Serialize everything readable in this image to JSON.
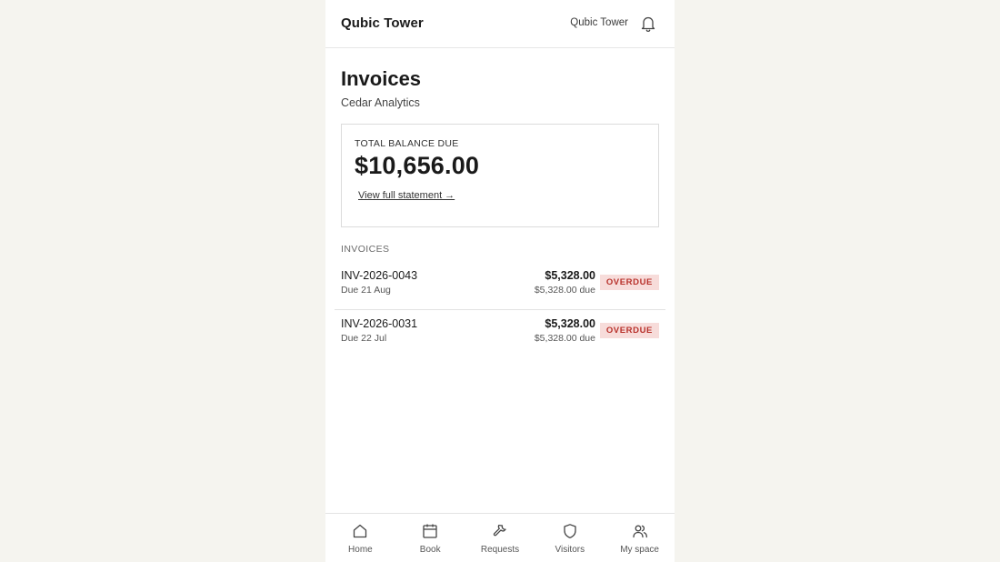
{
  "header": {
    "brand": "Qubic Tower",
    "building": "Qubic Tower",
    "bell_icon": "bell-icon"
  },
  "page": {
    "title": "Invoices",
    "tenant": "Cedar Analytics"
  },
  "balance": {
    "label": "TOTAL BALANCE DUE",
    "amount": "$10,656.00",
    "link": "View full statement →"
  },
  "invoices_section": {
    "label": "INVOICES",
    "items": [
      {
        "number": "INV-2026-0043",
        "due": "Due 21 Aug",
        "amount": "$5,328.00",
        "remaining": "$5,328.00 due",
        "status": "OVERDUE"
      },
      {
        "number": "INV-2026-0031",
        "due": "Due 22 Jul",
        "amount": "$5,328.00",
        "remaining": "$5,328.00 due",
        "status": "OVERDUE"
      }
    ]
  },
  "nav": {
    "items": [
      {
        "label": "Home",
        "icon": "home-icon"
      },
      {
        "label": "Book",
        "icon": "calendar-icon"
      },
      {
        "label": "Requests",
        "icon": "wrench-icon"
      },
      {
        "label": "Visitors",
        "icon": "shield-icon"
      },
      {
        "label": "My space",
        "icon": "people-icon"
      }
    ]
  },
  "colors": {
    "background": "#f5f4ef",
    "overdue_badge_bg": "#f7dcda",
    "overdue_badge_text": "#b8312b"
  }
}
